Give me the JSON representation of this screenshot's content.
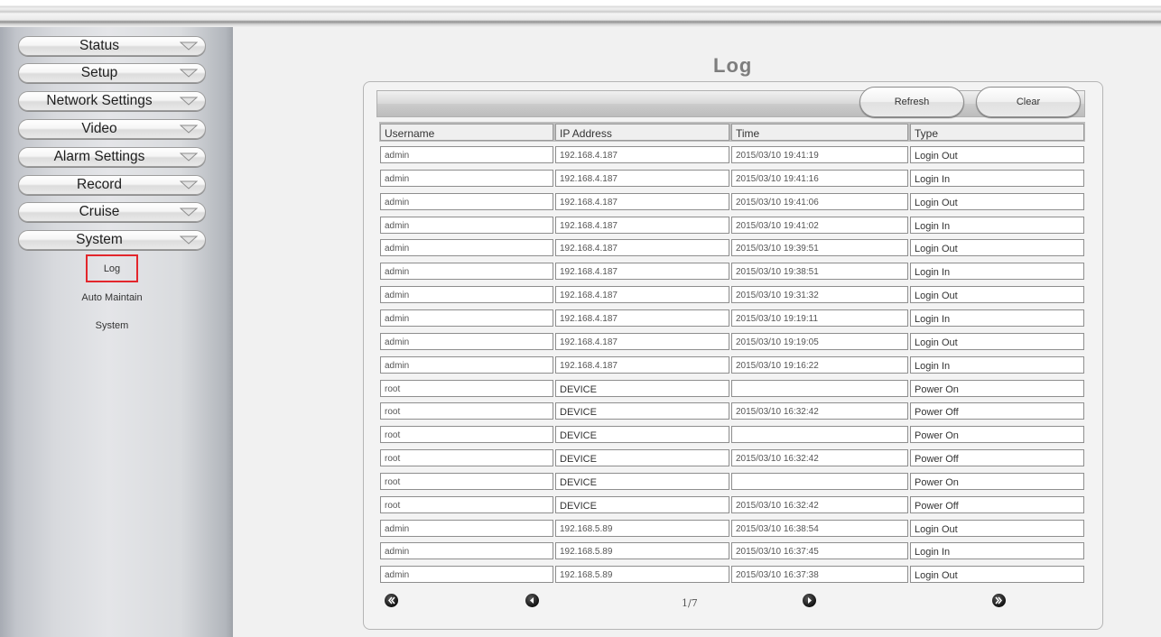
{
  "menu": [
    {
      "label": "Status"
    },
    {
      "label": "Setup"
    },
    {
      "label": "Network Settings"
    },
    {
      "label": "Video"
    },
    {
      "label": "Alarm Settings"
    },
    {
      "label": "Record"
    },
    {
      "label": "Cruise"
    },
    {
      "label": "System"
    }
  ],
  "submenu": [
    {
      "label": "Log"
    },
    {
      "label": "Auto Maintain"
    },
    {
      "label": "System"
    }
  ],
  "page": {
    "title": "Log"
  },
  "toolbar": {
    "refresh_label": "Refresh",
    "clear_label": "Clear"
  },
  "table": {
    "columns": [
      "Username",
      "IP Address",
      "Time",
      "Type"
    ],
    "rows": [
      [
        "admin",
        "192.168.4.187",
        "2015/03/10 19:41:19",
        "Login Out"
      ],
      [
        "admin",
        "192.168.4.187",
        "2015/03/10 19:41:16",
        "Login In"
      ],
      [
        "admin",
        "192.168.4.187",
        "2015/03/10 19:41:06",
        "Login Out"
      ],
      [
        "admin",
        "192.168.4.187",
        "2015/03/10 19:41:02",
        "Login In"
      ],
      [
        "admin",
        "192.168.4.187",
        "2015/03/10 19:39:51",
        "Login Out"
      ],
      [
        "admin",
        "192.168.4.187",
        "2015/03/10 19:38:51",
        "Login In"
      ],
      [
        "admin",
        "192.168.4.187",
        "2015/03/10 19:31:32",
        "Login Out"
      ],
      [
        "admin",
        "192.168.4.187",
        "2015/03/10 19:19:11",
        "Login In"
      ],
      [
        "admin",
        "192.168.4.187",
        "2015/03/10 19:19:05",
        "Login Out"
      ],
      [
        "admin",
        "192.168.4.187",
        "2015/03/10 19:16:22",
        "Login In"
      ],
      [
        "root",
        "DEVICE",
        "",
        "Power On"
      ],
      [
        "root",
        "DEVICE",
        "2015/03/10 16:32:42",
        "Power Off"
      ],
      [
        "root",
        "DEVICE",
        "",
        "Power On"
      ],
      [
        "root",
        "DEVICE",
        "2015/03/10 16:32:42",
        "Power Off"
      ],
      [
        "root",
        "DEVICE",
        "",
        "Power On"
      ],
      [
        "root",
        "DEVICE",
        "2015/03/10 16:32:42",
        "Power Off"
      ],
      [
        "admin",
        "192.168.5.89",
        "2015/03/10 16:38:54",
        "Login Out"
      ],
      [
        "admin",
        "192.168.5.89",
        "2015/03/10 16:37:45",
        "Login In"
      ],
      [
        "admin",
        "192.168.5.89",
        "2015/03/10 16:37:38",
        "Login Out"
      ]
    ]
  },
  "pager": {
    "label": "1/7",
    "first_icon": "first-page-icon",
    "prev_icon": "previous-page-icon",
    "next_icon": "next-page-icon",
    "last_icon": "last-page-icon"
  },
  "colors": {
    "highlight_border": "#e3262c",
    "title": "#7d7d7d"
  }
}
